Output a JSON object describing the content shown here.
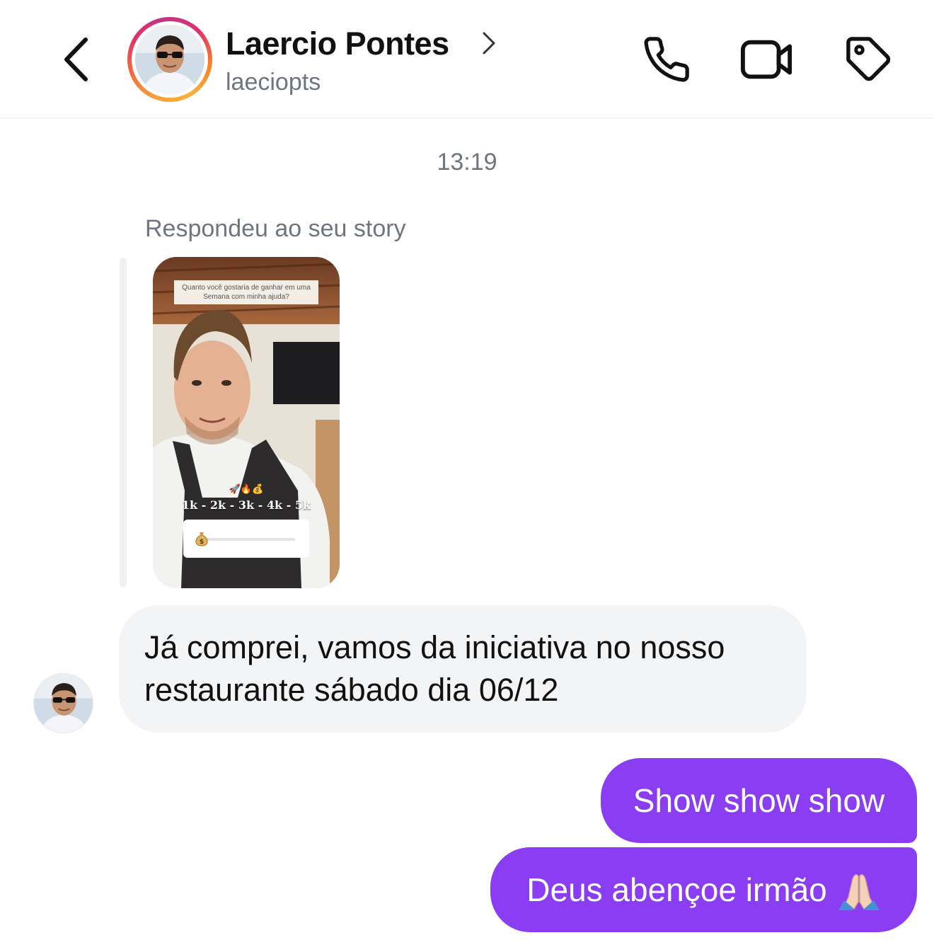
{
  "header": {
    "contact_name": "Laercio Pontes",
    "contact_handle": "laeciopts",
    "icons": [
      "back-arrow-icon",
      "chevron-right-icon",
      "phone-icon",
      "video-camera-icon",
      "tag-icon"
    ]
  },
  "conversation": {
    "timestamp": "13:19",
    "story_reply_label": "Respondeu ao seu story",
    "story": {
      "question": "Quanto você gostaria de ganhar em uma Semana com minha ajuda?",
      "emoji_row": "🚀🔥💰",
      "scale": "1k - 2k - 3k - 4k - 5k",
      "slider_icon": "money-bag-icon"
    },
    "messages": [
      {
        "direction": "incoming",
        "text": "Já comprei, vamos da iniciativa no nosso restaurante sábado dia 06/12"
      },
      {
        "direction": "outgoing",
        "text": "Show show show"
      },
      {
        "direction": "outgoing",
        "text": "Deus abençoe irmão"
      }
    ]
  },
  "colors": {
    "outgoing_bubble": "#8a3df2",
    "incoming_bubble": "#f3f4f6",
    "secondary_text": "#6f7580"
  }
}
